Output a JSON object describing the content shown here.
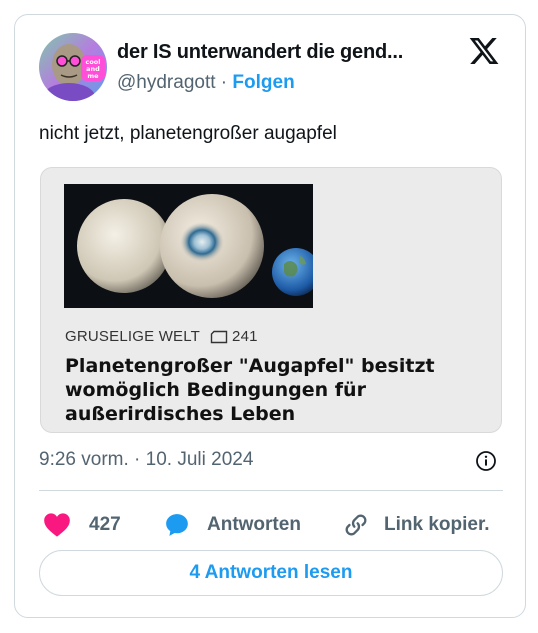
{
  "author": {
    "display_name": "der IS unterwandert die gend...",
    "handle": "@hydragott",
    "separator": "·",
    "follow_label": "Folgen",
    "avatar_text": [
      "cool",
      "and",
      "me"
    ]
  },
  "tweet": {
    "text": "nicht jetzt, planetengroßer augapfel"
  },
  "link_card": {
    "section": "GRUSELIGE WELT",
    "comment_count": "241",
    "headline": "Planetengroßer \"Augapfel\" besitzt womöglich Bedingungen für außerirdisches Leben"
  },
  "meta": {
    "timestamp": "9:26 vorm. · 10. Juli 2024"
  },
  "actions": {
    "like_count": "427",
    "reply_label": "Antworten",
    "copy_label": "Link kopier."
  },
  "footer": {
    "read_replies_label": "4 Antworten lesen"
  },
  "colors": {
    "accent": "#1d9bf0",
    "like": "#f91880",
    "secondary_text": "#536471",
    "border": "#cfd9de"
  },
  "icons": [
    "x-logo-icon",
    "comment-icon",
    "info-icon",
    "heart-icon",
    "reply-bubble-icon",
    "link-icon"
  ]
}
